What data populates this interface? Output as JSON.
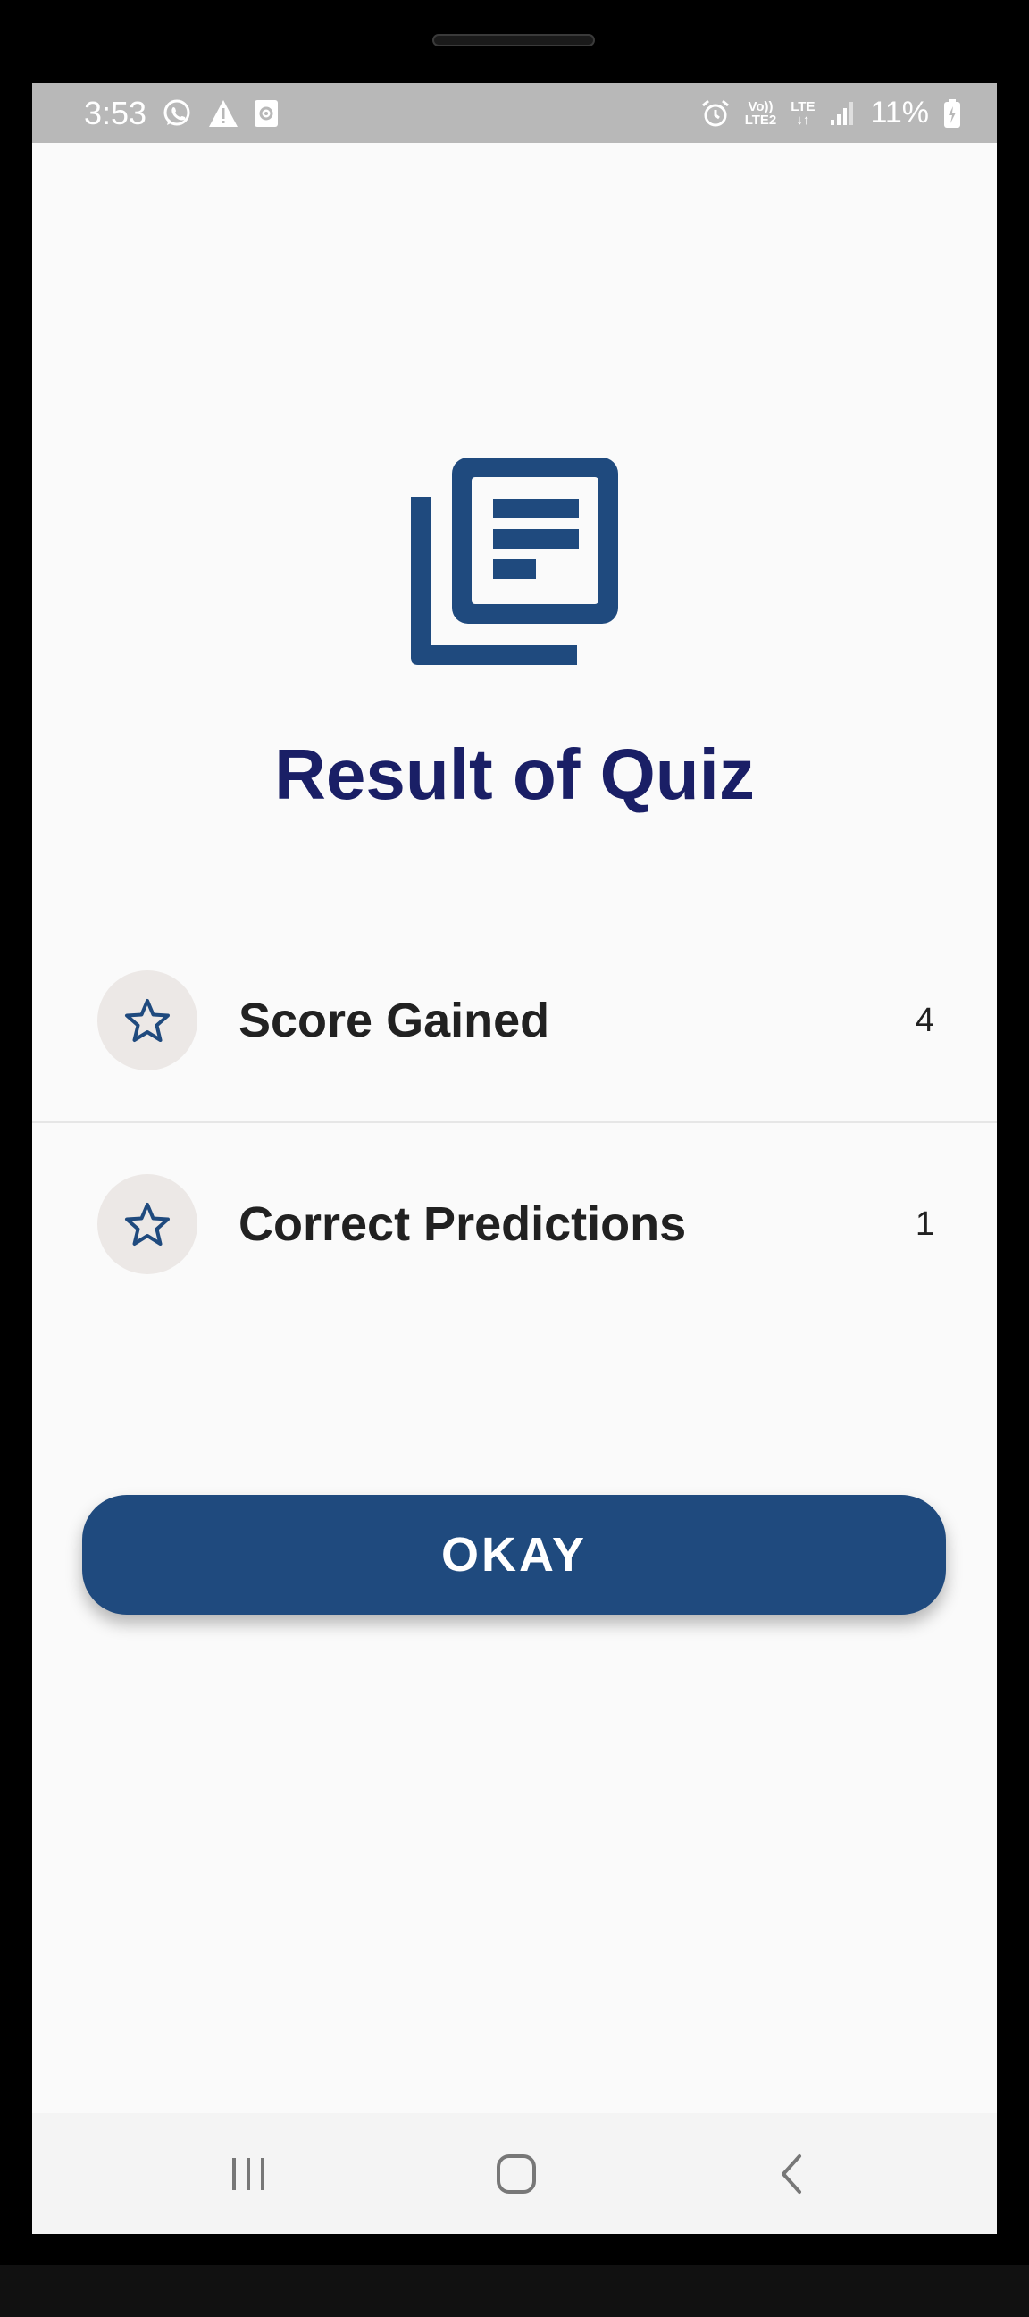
{
  "status_bar": {
    "time": "3:53",
    "left_icons": [
      "whatsapp-icon",
      "warning-icon",
      "screen-record-icon"
    ],
    "right_icons": [
      "alarm-icon",
      "volte-lte2-icon",
      "lte-data-icon",
      "signal-icon"
    ],
    "volte_top": "Vo))",
    "volte_bottom": "LTE2",
    "lte_label": "LTE",
    "battery": "11%"
  },
  "hero": {
    "icon": "article-stack-icon",
    "color": "#1f4a7e"
  },
  "title": "Result of Quiz",
  "results": [
    {
      "icon": "star-outline-icon",
      "label": "Score Gained",
      "value": "4"
    },
    {
      "icon": "star-outline-icon",
      "label": "Correct Predictions",
      "value": "1"
    }
  ],
  "okay_button": {
    "label": "OKAY",
    "color": "#1f4a7e"
  },
  "nav": {
    "recent": "recent-apps-icon",
    "home": "home-icon",
    "back": "back-icon"
  },
  "colors": {
    "title": "#1a1f66",
    "status_bar": "#b8b8b8",
    "icon_circle": "#ece8e6"
  }
}
